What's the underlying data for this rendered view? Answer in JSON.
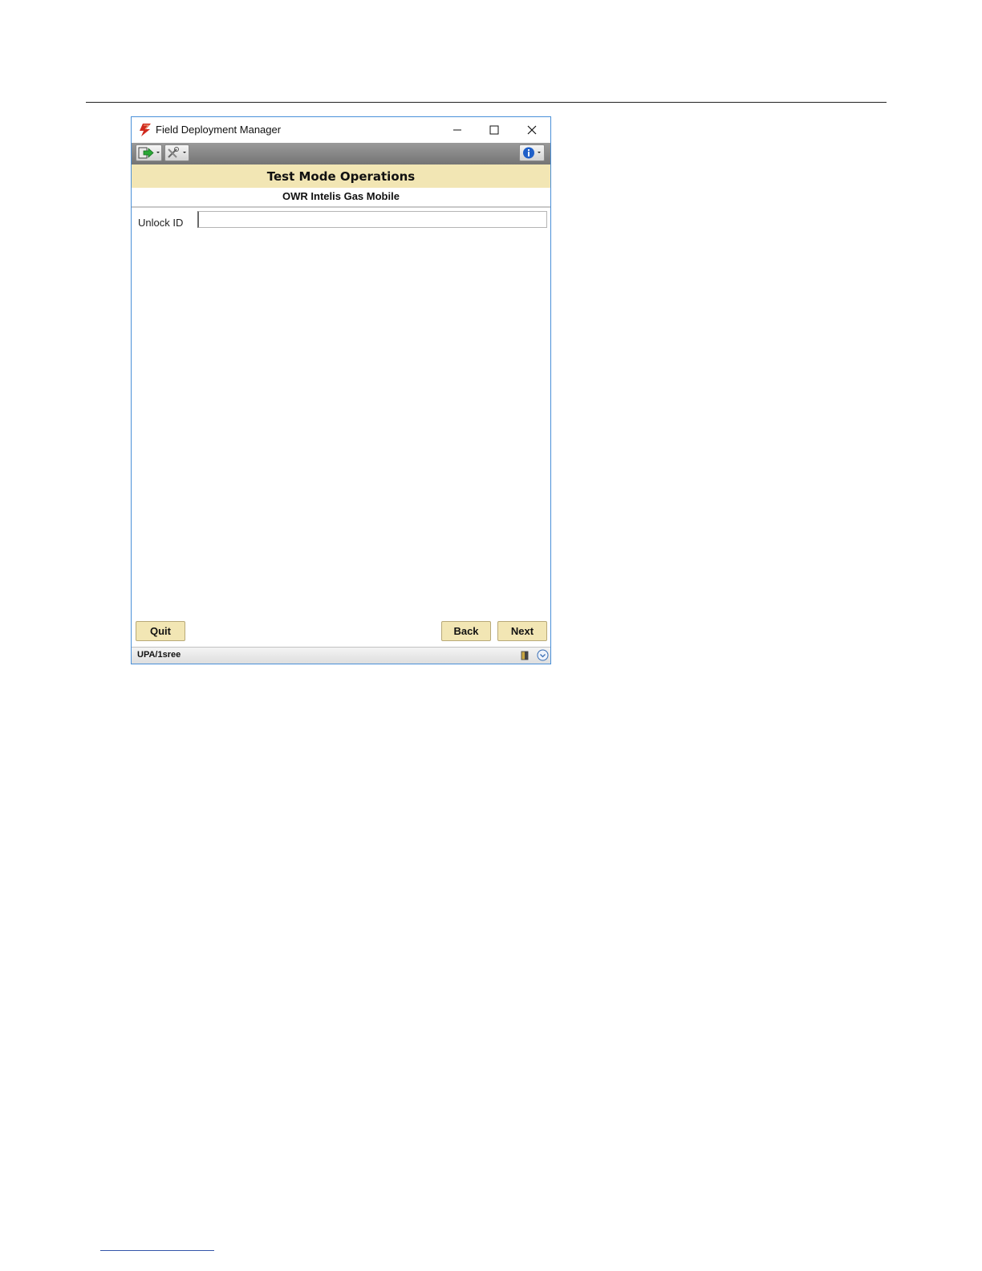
{
  "window": {
    "title": "Field Deployment Manager"
  },
  "toolbar": {
    "exit_icon": "exit-arrow-icon",
    "tools_icon": "tools-icon",
    "info_icon": "info-icon"
  },
  "header": {
    "title": "Test Mode Operations",
    "subtitle": "OWR Intelis Gas Mobile"
  },
  "form": {
    "unlock_id_label": "Unlock ID",
    "unlock_id_value": ""
  },
  "buttons": {
    "quit": "Quit",
    "back": "Back",
    "next": "Next"
  },
  "status": {
    "text": "UPA/1sree"
  },
  "colors": {
    "header_band": "#f2e6b4",
    "toolbar": "#8a8a8a",
    "window_border": "#4a90d9"
  }
}
